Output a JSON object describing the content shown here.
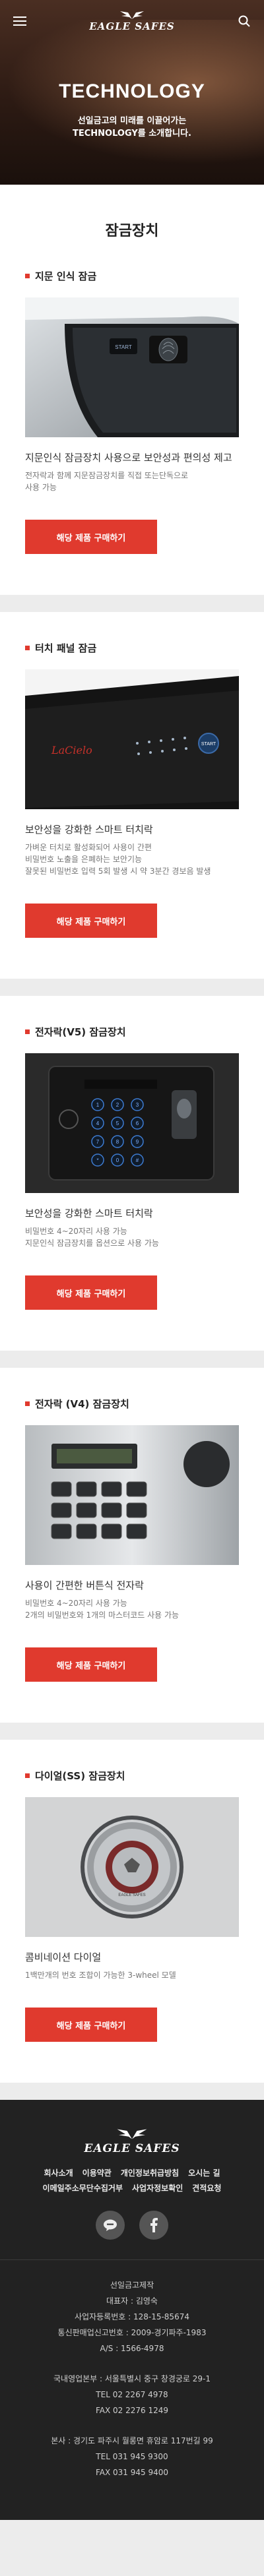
{
  "header": {
    "logo": "EAGLE SAFES",
    "menu_icon": "menu-icon",
    "search_icon": "search-icon"
  },
  "hero": {
    "title": "TECHNOLOGY",
    "subtitle": "선일금고의 미래를 이끌어가는 TECHNOLOGY를 소개합니다."
  },
  "section": {
    "title": "잠금장치"
  },
  "cards": [
    {
      "title": "지문 인식 잠금",
      "desc_title": "지문인식 잠금장치 사용으로 보안성과 편의성 제고",
      "desc": "전자락과 함께 지문잠금장치를 직접 또는단독으로\n사용 가능",
      "button": "해당 제품 구매하기"
    },
    {
      "title": "터치 패널 잠금",
      "desc_title": "보안성을 강화한 스마트 터치락",
      "desc": "가벼운 터치로 활성화되어 사용이 간편\n비밀번호 노출을 은폐하는 보안기능\n잘못된 비밀번호 입력 5회 발생 시 약 3분간 경보음 발생",
      "button": "해당 제품 구매하기"
    },
    {
      "title": "전자락(V5) 잠금장치",
      "desc_title": "보안성을 강화한 스마트 터치락",
      "desc": "비밀번호 4~20자리 사용 가능\n지문인식 잠금장치를 옵션으로 사용 가능",
      "button": "해당 제품 구매하기"
    },
    {
      "title": "전자락 (V4) 잠금장치",
      "desc_title": "사용이 간편한 버튼식 전자락",
      "desc": "비밀번호 4~20자리 사용 가능\n2개의 비밀번호와 1개의 마스터코드 사용 가능",
      "button": "해당 제품 구매하기"
    },
    {
      "title": "다이얼(SS) 잠금장치",
      "desc_title": "콤비네이션 다이얼",
      "desc": "1백만개의 번호 조합이 가능한 3-wheel 모델",
      "button": "해당 제품 구매하기"
    }
  ],
  "images": {
    "fingerprint_brand": "START",
    "touch_brand": "LaCielo",
    "touch_start": "START",
    "v5_keys": [
      "1",
      "2",
      "3",
      "4",
      "5",
      "6",
      "7",
      "8",
      "9",
      "*",
      "0",
      "#"
    ],
    "dial_brand": "EAGLE SAFES"
  },
  "footer": {
    "logo": "EAGLE SAFES",
    "links": [
      "회사소개",
      "이용약관",
      "개인정보취급방침",
      "오시는 길",
      "이메일주소무단수집거부",
      "사업자정보확인",
      "견적요청"
    ],
    "info_lines": [
      "선일금고제작",
      "대표자 : 김영숙",
      "사업자등록번호 : 128-15-85674",
      "통신판매업신고번호 : 2009-경기파주-1983",
      "A/S : 1566-4978"
    ],
    "address_lines": [
      "국내영업본부 : 서울특별시 중구 창경궁로 29-1",
      "TEL 02 2267 4978",
      "FAX 02 2276 1249"
    ],
    "hq_lines": [
      "본사 : 경기도 파주시 월롱면 휴암로 117번길 99",
      "TEL 031 945 9300",
      "FAX 031 945 9400"
    ]
  },
  "colors": {
    "accent": "#e03a2e",
    "footer_bg": "#222222",
    "page_bg": "#ececec"
  }
}
